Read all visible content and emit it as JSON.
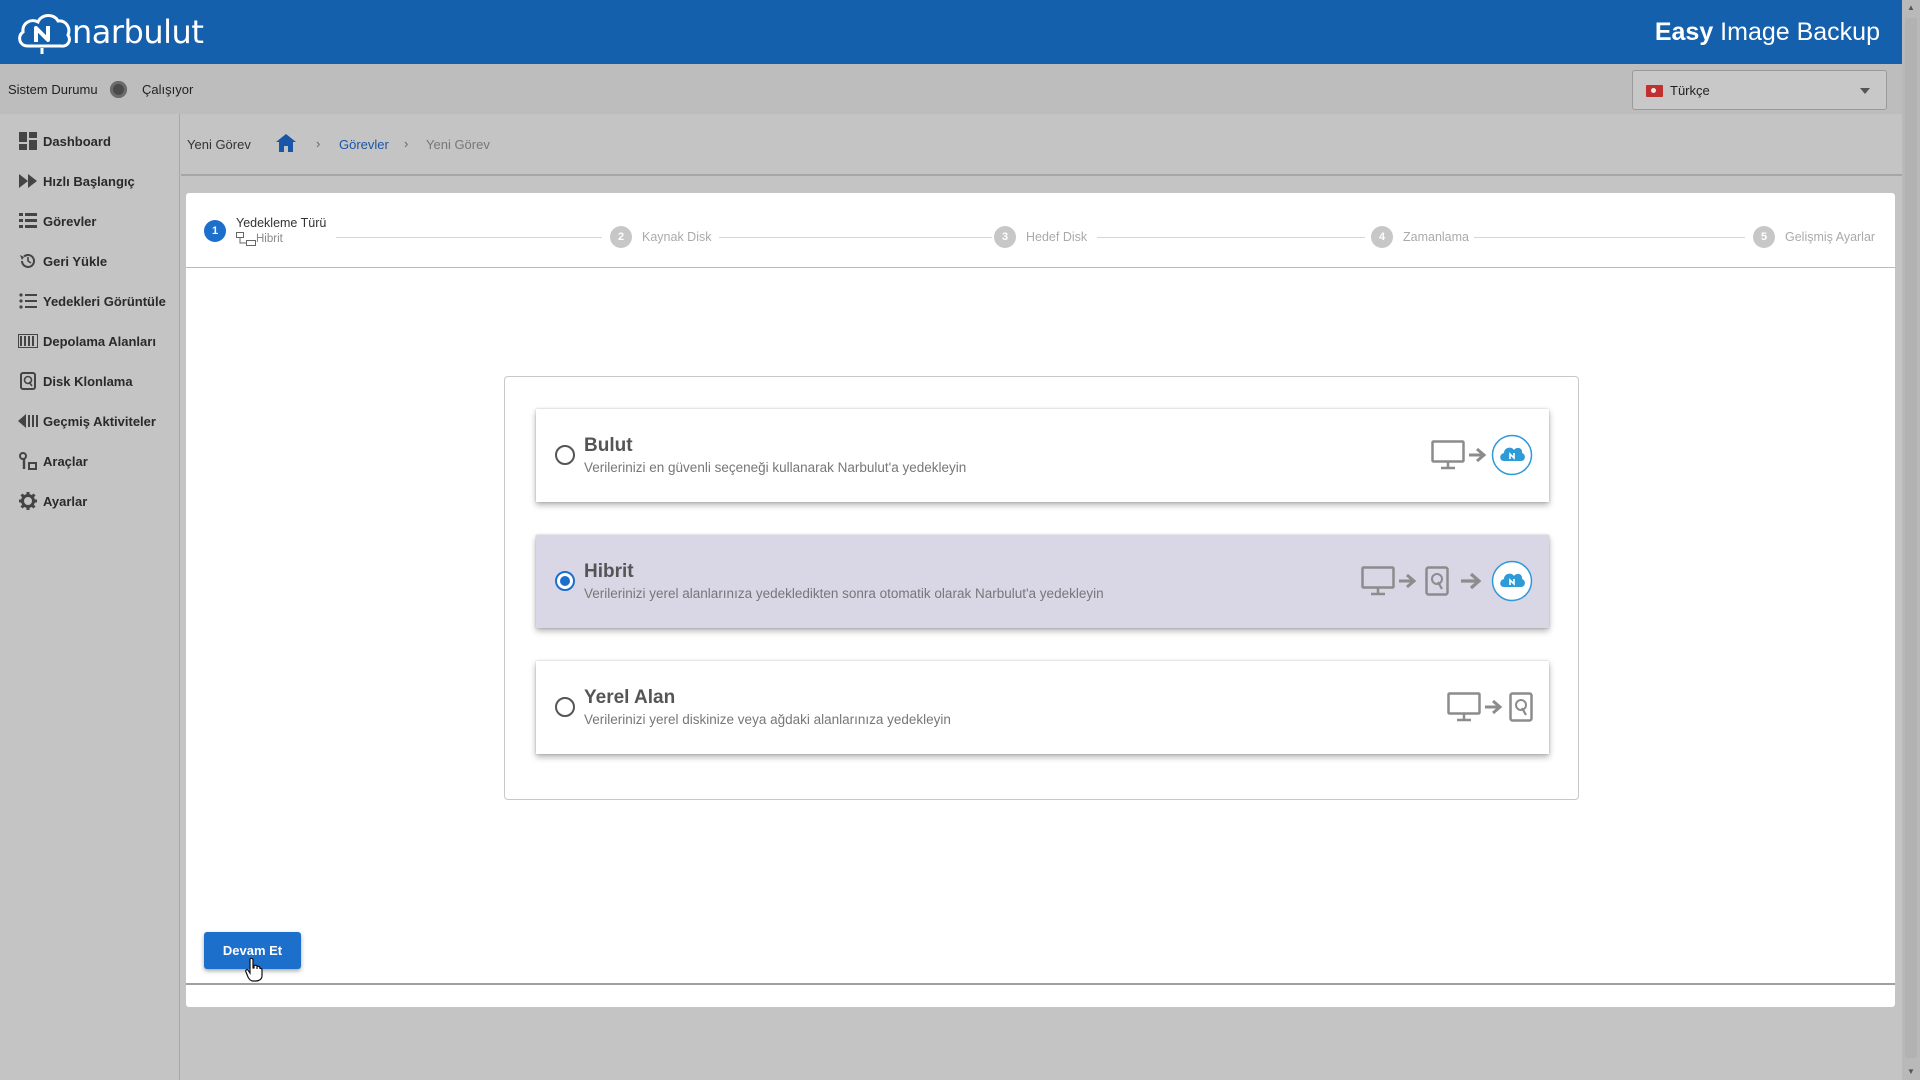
{
  "header": {
    "logo_text": "narbulut",
    "app_title_bold": "Easy",
    "app_title_rest": " Image Backup"
  },
  "status": {
    "label": "Sistem Durumu",
    "value": "Çalışıyor"
  },
  "language": {
    "selected": "Türkçe"
  },
  "sidebar": {
    "items": [
      {
        "label": "Dashboard",
        "icon": "dashboard-icon"
      },
      {
        "label": "Hızlı Başlangıç",
        "icon": "fast-forward-icon"
      },
      {
        "label": "Görevler",
        "icon": "list-icon"
      },
      {
        "label": "Geri Yükle",
        "icon": "restore-icon"
      },
      {
        "label": "Yedekleri Görüntüle",
        "icon": "view-list-icon"
      },
      {
        "label": "Depolama Alanları",
        "icon": "storage-icon"
      },
      {
        "label": "Disk Klonlama",
        "icon": "disk-icon"
      },
      {
        "label": "Geçmiş Aktiviteler",
        "icon": "history-icon"
      },
      {
        "label": "Araçlar",
        "icon": "tools-icon"
      },
      {
        "label": "Ayarlar",
        "icon": "gear-icon"
      }
    ]
  },
  "breadcrumb": {
    "title": "Yeni Görev",
    "link": "Görevler",
    "separator": "›",
    "current": "Yeni Görev"
  },
  "stepper": {
    "steps": [
      {
        "num": "1",
        "label": "Yedekleme Türü",
        "sub": "Hibrit"
      },
      {
        "num": "2",
        "label": "Kaynak Disk"
      },
      {
        "num": "3",
        "label": "Hedef Disk"
      },
      {
        "num": "4",
        "label": "Zamanlama"
      },
      {
        "num": "5",
        "label": "Gelişmiş Ayarlar"
      }
    ]
  },
  "options": [
    {
      "title": "Bulut",
      "desc": "Verilerinizi en güvenli seçeneği kullanarak Narbulut'a yedekleyin",
      "selected": false
    },
    {
      "title": "Hibrit",
      "desc": "Verilerinizi yerel alanlarınıza yedekledikten sonra otomatik olarak Narbulut'a yedekleyin",
      "selected": true
    },
    {
      "title": "Yerel Alan",
      "desc": "Verilerinizi yerel diskinize veya ağdaki alanlarınıza yedekleyin",
      "selected": false
    }
  ],
  "actions": {
    "continue_label": "Devam Et"
  },
  "colors": {
    "header": "#1560ad",
    "accent": "#1d6fcc",
    "selected_option": "#d9d6e6"
  }
}
